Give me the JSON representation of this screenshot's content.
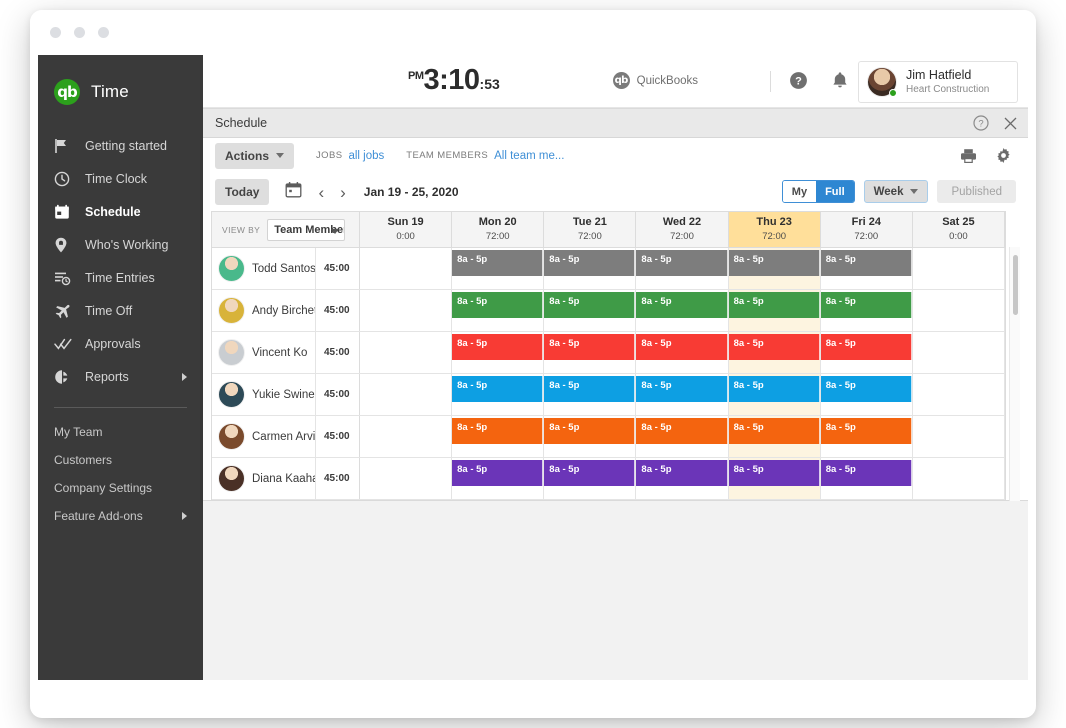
{
  "window": {
    "traffic_lights": 3
  },
  "sidebar": {
    "brand": {
      "mark": "qb",
      "label": "Time"
    },
    "items": [
      {
        "label": "Getting started",
        "icon": "flag-icon",
        "active": false,
        "caret": false
      },
      {
        "label": "Time Clock",
        "icon": "clock-icon",
        "active": false,
        "caret": false
      },
      {
        "label": "Schedule",
        "icon": "calendar-icon",
        "active": true,
        "caret": false
      },
      {
        "label": "Who's Working",
        "icon": "location-pin-icon",
        "active": false,
        "caret": false
      },
      {
        "label": "Time Entries",
        "icon": "list-clock-icon",
        "active": false,
        "caret": false
      },
      {
        "label": "Time Off",
        "icon": "airplane-icon",
        "active": false,
        "caret": false
      },
      {
        "label": "Approvals",
        "icon": "double-check-icon",
        "active": false,
        "caret": false
      },
      {
        "label": "Reports",
        "icon": "pie-chart-icon",
        "active": false,
        "caret": true
      }
    ],
    "sub_items": [
      {
        "label": "My Team",
        "caret": false
      },
      {
        "label": "Customers",
        "caret": false
      },
      {
        "label": "Company Settings",
        "caret": false
      },
      {
        "label": "Feature Add-ons",
        "caret": true
      }
    ]
  },
  "topbar": {
    "clock": {
      "ampm": "PM",
      "hours_minutes": "3:10",
      "seconds": ":53"
    },
    "quickbooks_label": "QuickBooks",
    "quickbooks_mark": "qb",
    "help_icon": "help-circle-icon",
    "bell_icon": "notification-bell-icon",
    "account": {
      "name": "Jim Hatfield",
      "company": "Heart Construction"
    }
  },
  "schedule": {
    "panel_title": "Schedule",
    "header_icons": [
      "help-circle-icon",
      "close-icon"
    ],
    "toolbar_icons": [
      "printer-icon",
      "gear-icon"
    ],
    "actions_label": "Actions",
    "jobs_label": "JOBS",
    "jobs_value": "all jobs",
    "team_members_label": "TEAM MEMBERS",
    "team_members_value": "All team me...",
    "today_label": "Today",
    "calendar_icon": "calendar-icon",
    "prev_icon": "chevron-left-icon",
    "next_icon": "chevron-right-icon",
    "date_range": "Jan 19 - 25, 2020",
    "segment": {
      "my_label": "My",
      "full_label": "Full",
      "selected": "Full"
    },
    "week_label": "Week",
    "published_label": "Published",
    "view_by_label": "VIEW BY",
    "view_by_value": "Team Member",
    "days": [
      {
        "name": "Sun 19",
        "hours": "0:00",
        "today": false
      },
      {
        "name": "Mon 20",
        "hours": "72:00",
        "today": false
      },
      {
        "name": "Tue 21",
        "hours": "72:00",
        "today": false
      },
      {
        "name": "Wed 22",
        "hours": "72:00",
        "today": false
      },
      {
        "name": "Thu 23",
        "hours": "72:00",
        "today": true
      },
      {
        "name": "Fri 24",
        "hours": "72:00",
        "today": false
      },
      {
        "name": "Sat 25",
        "hours": "0:00",
        "today": false
      }
    ],
    "shift_label": "8a - 5p",
    "rows": [
      {
        "name": "Todd Santos",
        "hours": "45:00",
        "color": "#7d7d7d",
        "avatar": "#49b98b",
        "shifts": [
          false,
          true,
          true,
          true,
          true,
          true,
          false
        ]
      },
      {
        "name": "Andy Birchett",
        "hours": "45:00",
        "color": "#3f9b47",
        "avatar": "#d8b33a",
        "shifts": [
          false,
          true,
          true,
          true,
          true,
          true,
          false
        ]
      },
      {
        "name": "Vincent Ko",
        "hours": "45:00",
        "color": "#f83b34",
        "avatar": "#c9cdd1",
        "shifts": [
          false,
          true,
          true,
          true,
          true,
          true,
          false
        ]
      },
      {
        "name": "Yukie Swinehart",
        "hours": "45:00",
        "color": "#0d9fe3",
        "avatar": "#2d4a57",
        "shifts": [
          false,
          true,
          true,
          true,
          true,
          true,
          false
        ]
      },
      {
        "name": "Carmen Arvizu",
        "hours": "45:00",
        "color": "#f4640f",
        "avatar": "#7a4a2c",
        "shifts": [
          false,
          true,
          true,
          true,
          true,
          true,
          false
        ]
      },
      {
        "name": "Diana Kaaha",
        "hours": "45:00",
        "color": "#6b35b8",
        "avatar": "#4a3026",
        "shifts": [
          false,
          true,
          true,
          true,
          true,
          true,
          false
        ]
      }
    ]
  },
  "colors": {
    "brand_green": "#2ca01c",
    "accent_blue": "#2e87d2",
    "link_blue": "#3f8fd6",
    "today_header": "#ffdf9a",
    "today_cell": "#fdf4e0",
    "sidebar_bg": "#3a3a3a"
  }
}
